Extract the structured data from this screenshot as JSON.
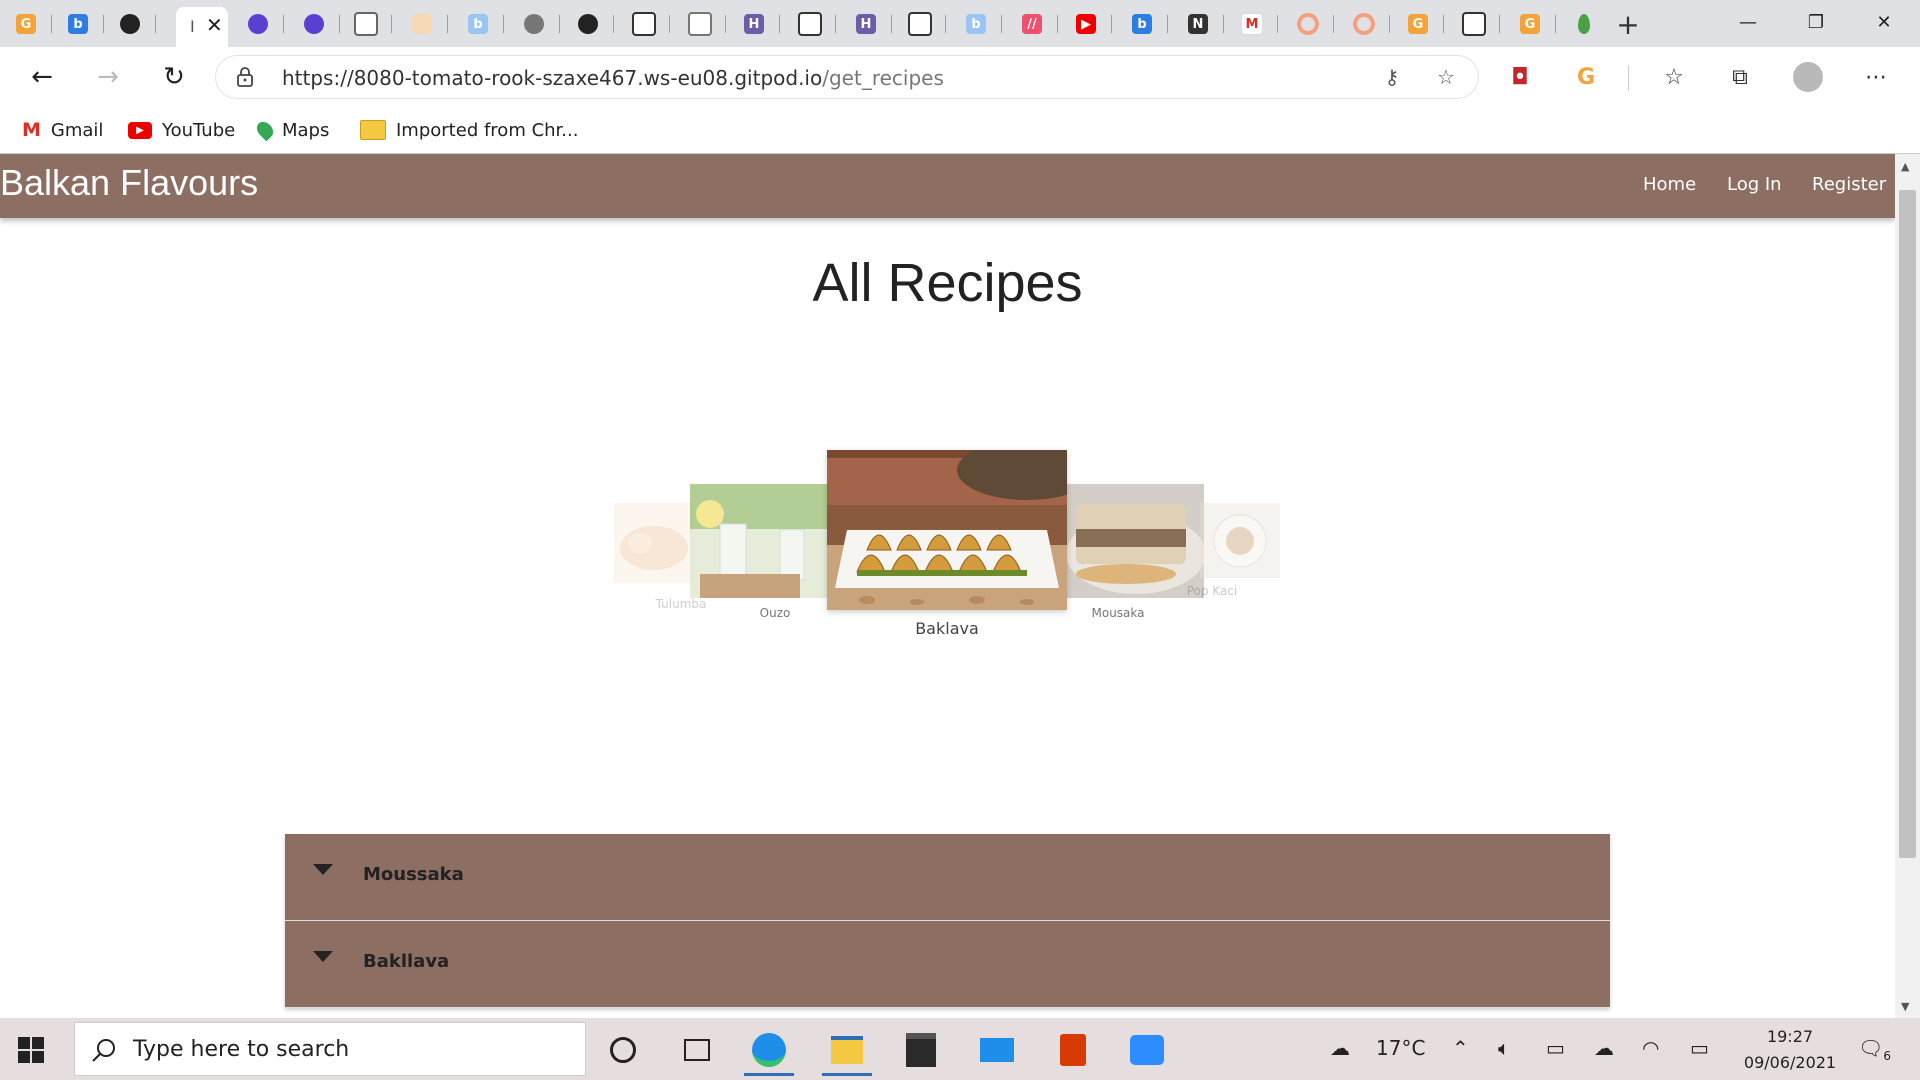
{
  "browser": {
    "url_host": "https://8080-tomato-rook-szaxe467.ws-eu08.gitpod.io",
    "url_path": "/get_recipes",
    "bookmarks": [
      {
        "label": "Gmail",
        "icon": "gmail-icon"
      },
      {
        "label": "YouTube",
        "icon": "youtube-icon"
      },
      {
        "label": "Maps",
        "icon": "maps-icon"
      },
      {
        "label": "Imported from Chr...",
        "icon": "folder-icon"
      }
    ]
  },
  "site": {
    "brand": "Balkan Flavours",
    "nav": [
      {
        "label": "Home"
      },
      {
        "label": "Log In"
      },
      {
        "label": "Register"
      }
    ],
    "title": "All Recipes",
    "carousel": [
      {
        "caption": "Tulumba",
        "colors": [
          "#f3d2b3",
          "#e9b994"
        ]
      },
      {
        "caption": "Ouzo",
        "colors": [
          "#a9c98a",
          "#e6e8da"
        ]
      },
      {
        "caption": "Baklava",
        "colors": [
          "#b9854a",
          "#5b7a2b"
        ]
      },
      {
        "caption": "Mousaka",
        "colors": [
          "#c9b7a0",
          "#7a5b3a"
        ]
      },
      {
        "caption": "Pop Kaci",
        "colors": [
          "#e8ddd2",
          "#b08a62"
        ]
      }
    ],
    "recipes": [
      {
        "name": "Moussaka"
      },
      {
        "name": "Bakllava"
      }
    ]
  },
  "taskbar": {
    "search_placeholder": "Type here to search",
    "weather": "17°C",
    "time": "19:27",
    "date": "09/06/2021",
    "notifications": "6"
  },
  "colors": {
    "brand": "#8d6e63",
    "accent": "#2c6fb7"
  }
}
